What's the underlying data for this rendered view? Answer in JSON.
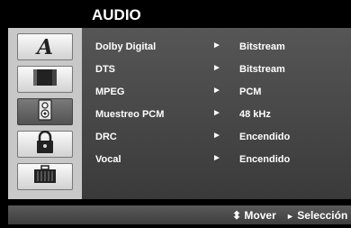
{
  "title": "AUDIO",
  "sidebar": {
    "tabs": [
      {
        "icon": "letter-a-icon",
        "glyph": "A",
        "active": false
      },
      {
        "icon": "display-icon",
        "active": false
      },
      {
        "icon": "speaker-icon",
        "active": true
      },
      {
        "icon": "lock-icon",
        "active": false
      },
      {
        "icon": "toolbox-icon",
        "active": false
      }
    ]
  },
  "settings": [
    {
      "label": "Dolby Digital",
      "arrow": "►",
      "value": "Bitstream"
    },
    {
      "label": "DTS",
      "arrow": "►",
      "value": "Bitstream"
    },
    {
      "label": "MPEG",
      "arrow": "►",
      "value": "PCM"
    },
    {
      "label": "Muestreo PCM",
      "arrow": "►",
      "value": "48 kHz"
    },
    {
      "label": "DRC",
      "arrow": "►",
      "value": "Encendido"
    },
    {
      "label": "Vocal",
      "arrow": "►",
      "value": "Encendido"
    }
  ],
  "footer": {
    "move_icon": "⬍",
    "move_label": "Mover",
    "select_icon": "►",
    "select_label": "Selección"
  }
}
